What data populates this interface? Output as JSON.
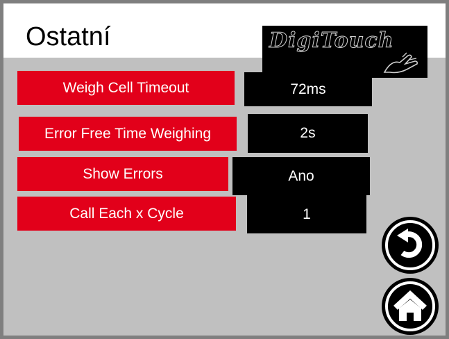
{
  "header": {
    "title": "Ostatní",
    "logo_text": "DigiTouch",
    "logo_icon": "hand-touch-icon"
  },
  "settings": [
    {
      "label": "Weigh Cell Timeout",
      "value": "72ms"
    },
    {
      "label": "Error Free Time Weighing",
      "value": "2s"
    },
    {
      "label": "Show Errors",
      "value": "Ano"
    },
    {
      "label": "Call Each x Cycle",
      "value": "1"
    }
  ],
  "nav": {
    "back_icon": "back-arrow-icon",
    "home_icon": "home-icon"
  },
  "colors": {
    "accent": "#e2001a",
    "value_bg": "#000000",
    "panel_bg": "#c0c0c0",
    "header_bg": "#ffffff"
  }
}
